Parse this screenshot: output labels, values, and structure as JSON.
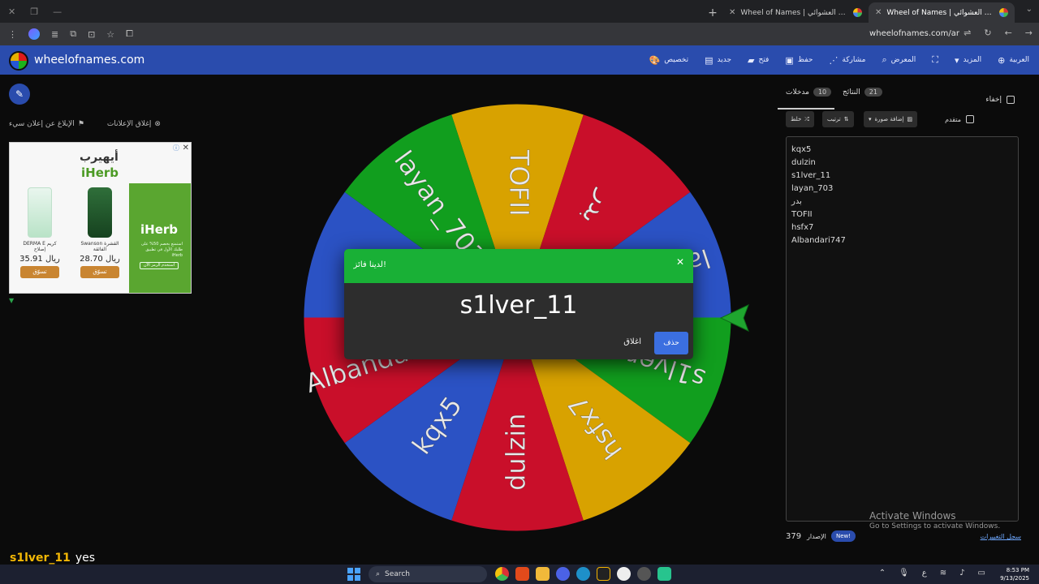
{
  "browser": {
    "tabs": [
      {
        "title": "Wheel of Names | الاسم العشوائي",
        "active": false
      },
      {
        "title": "Wheel of Names | الاسم العشوائي",
        "active": true
      }
    ],
    "url": "wheelofnames.com/ar"
  },
  "header": {
    "logo_text": "wheelofnames.com",
    "nav": [
      {
        "label": "تخصيص",
        "icon": "palette-icon"
      },
      {
        "label": "جديد",
        "icon": "file-icon"
      },
      {
        "label": "فتح",
        "icon": "folder-icon"
      },
      {
        "label": "حفظ",
        "icon": "save-icon"
      },
      {
        "label": "مشاركة",
        "icon": "share-icon"
      },
      {
        "label": "المعرض",
        "icon": "search-icon"
      },
      {
        "label": "",
        "icon": "fullscreen-icon"
      },
      {
        "label": "المزيد",
        "icon": "chevron-down-icon"
      },
      {
        "label": "العربية",
        "icon": "globe-icon"
      }
    ]
  },
  "left": {
    "ad_close_label": "إغلاق الإعلانات",
    "ad_report_label": "الإبلاغ عن إعلان سيء",
    "ad": {
      "brand_ar": "أيهيرب",
      "brand": "iHerb",
      "green_logo": "iHerb",
      "green_text": "استمتع بخصم 50% على طلبك الأول في تطبيق iHerb",
      "green_button": "استخدم الرمز الآن",
      "products": [
        {
          "name": "DERMA E كريم إصلاح",
          "price": "35.91 ريال",
          "buy": "تسوّق"
        },
        {
          "name": "Swanson القشرة الفائقة",
          "price": "28.70 ريال",
          "buy": "تسوّق"
        }
      ]
    }
  },
  "wheel": {
    "segments": [
      {
        "label": "TOFII",
        "color": "#d8a200"
      },
      {
        "label": "بدر",
        "color": "#c90f2a"
      },
      {
        "label": "layan_703",
        "color": "#2b52c4"
      },
      {
        "label": "s1lver_11",
        "color": "#119e1e"
      },
      {
        "label": "hsfx7",
        "color": "#d8a200"
      },
      {
        "label": "dulzin",
        "color": "#c90f2a"
      },
      {
        "label": "kqx5",
        "color": "#2b52c4"
      },
      {
        "label": "Albandari747",
        "color": "#c90f2a"
      },
      {
        "label": "hsfx7",
        "color": "#2b52c4"
      },
      {
        "label": "layan_703",
        "color": "#119e1e"
      }
    ]
  },
  "dialog": {
    "title": "لدينا فائز!",
    "winner": "s1lver_11",
    "close_label": "اغلاق",
    "delete_label": "حذف"
  },
  "panel": {
    "entries_tab": {
      "label": "مدخلات",
      "count": "10"
    },
    "results_tab": {
      "label": "النتائج",
      "count": "21"
    },
    "hide_label": "إخفاء",
    "shuffle_label": "خلط",
    "sort_label": "ترتيب",
    "add_image_label": "إضافة صورة",
    "advanced_label": "متقدم",
    "entries": [
      "kqx5",
      "dulzin",
      "s1lver_11",
      "layan_703",
      "بدر",
      "TOFII",
      "hsfx7",
      "Albandari747"
    ],
    "version": "379",
    "version_label": "الإصدار",
    "new_badge": "New!",
    "changelog": "سجل التغييرات"
  },
  "windows": {
    "activate_title": "Activate Windows",
    "activate_sub": "Go to Settings to activate Windows."
  },
  "overlay": {
    "name": "s1lver_11",
    "word": "yes"
  },
  "taskbar": {
    "search": "Search",
    "lang": "ع",
    "time": "8:53 PM",
    "date": "9/13/2025"
  }
}
